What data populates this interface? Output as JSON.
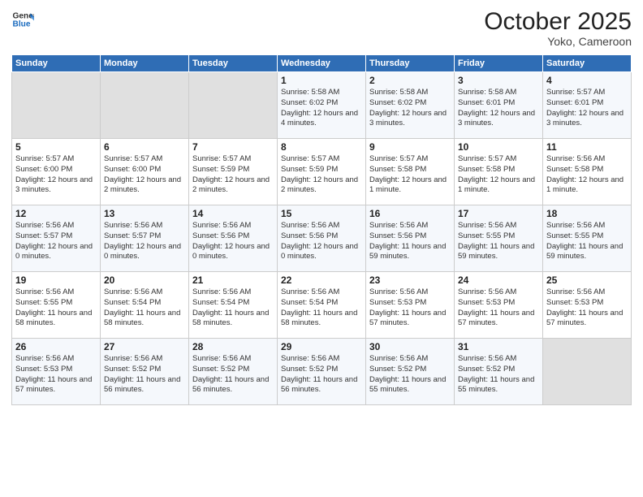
{
  "header": {
    "logo_line1": "General",
    "logo_line2": "Blue",
    "month": "October 2025",
    "location": "Yoko, Cameroon"
  },
  "weekdays": [
    "Sunday",
    "Monday",
    "Tuesday",
    "Wednesday",
    "Thursday",
    "Friday",
    "Saturday"
  ],
  "weeks": [
    [
      {
        "day": "",
        "empty": true
      },
      {
        "day": "",
        "empty": true
      },
      {
        "day": "",
        "empty": true
      },
      {
        "day": "1",
        "sunrise": "Sunrise: 5:58 AM",
        "sunset": "Sunset: 6:02 PM",
        "daylight": "Daylight: 12 hours and 4 minutes."
      },
      {
        "day": "2",
        "sunrise": "Sunrise: 5:58 AM",
        "sunset": "Sunset: 6:02 PM",
        "daylight": "Daylight: 12 hours and 3 minutes."
      },
      {
        "day": "3",
        "sunrise": "Sunrise: 5:58 AM",
        "sunset": "Sunset: 6:01 PM",
        "daylight": "Daylight: 12 hours and 3 minutes."
      },
      {
        "day": "4",
        "sunrise": "Sunrise: 5:57 AM",
        "sunset": "Sunset: 6:01 PM",
        "daylight": "Daylight: 12 hours and 3 minutes."
      }
    ],
    [
      {
        "day": "5",
        "sunrise": "Sunrise: 5:57 AM",
        "sunset": "Sunset: 6:00 PM",
        "daylight": "Daylight: 12 hours and 3 minutes."
      },
      {
        "day": "6",
        "sunrise": "Sunrise: 5:57 AM",
        "sunset": "Sunset: 6:00 PM",
        "daylight": "Daylight: 12 hours and 2 minutes."
      },
      {
        "day": "7",
        "sunrise": "Sunrise: 5:57 AM",
        "sunset": "Sunset: 5:59 PM",
        "daylight": "Daylight: 12 hours and 2 minutes."
      },
      {
        "day": "8",
        "sunrise": "Sunrise: 5:57 AM",
        "sunset": "Sunset: 5:59 PM",
        "daylight": "Daylight: 12 hours and 2 minutes."
      },
      {
        "day": "9",
        "sunrise": "Sunrise: 5:57 AM",
        "sunset": "Sunset: 5:58 PM",
        "daylight": "Daylight: 12 hours and 1 minute."
      },
      {
        "day": "10",
        "sunrise": "Sunrise: 5:57 AM",
        "sunset": "Sunset: 5:58 PM",
        "daylight": "Daylight: 12 hours and 1 minute."
      },
      {
        "day": "11",
        "sunrise": "Sunrise: 5:56 AM",
        "sunset": "Sunset: 5:58 PM",
        "daylight": "Daylight: 12 hours and 1 minute."
      }
    ],
    [
      {
        "day": "12",
        "sunrise": "Sunrise: 5:56 AM",
        "sunset": "Sunset: 5:57 PM",
        "daylight": "Daylight: 12 hours and 0 minutes."
      },
      {
        "day": "13",
        "sunrise": "Sunrise: 5:56 AM",
        "sunset": "Sunset: 5:57 PM",
        "daylight": "Daylight: 12 hours and 0 minutes."
      },
      {
        "day": "14",
        "sunrise": "Sunrise: 5:56 AM",
        "sunset": "Sunset: 5:56 PM",
        "daylight": "Daylight: 12 hours and 0 minutes."
      },
      {
        "day": "15",
        "sunrise": "Sunrise: 5:56 AM",
        "sunset": "Sunset: 5:56 PM",
        "daylight": "Daylight: 12 hours and 0 minutes."
      },
      {
        "day": "16",
        "sunrise": "Sunrise: 5:56 AM",
        "sunset": "Sunset: 5:56 PM",
        "daylight": "Daylight: 11 hours and 59 minutes."
      },
      {
        "day": "17",
        "sunrise": "Sunrise: 5:56 AM",
        "sunset": "Sunset: 5:55 PM",
        "daylight": "Daylight: 11 hours and 59 minutes."
      },
      {
        "day": "18",
        "sunrise": "Sunrise: 5:56 AM",
        "sunset": "Sunset: 5:55 PM",
        "daylight": "Daylight: 11 hours and 59 minutes."
      }
    ],
    [
      {
        "day": "19",
        "sunrise": "Sunrise: 5:56 AM",
        "sunset": "Sunset: 5:55 PM",
        "daylight": "Daylight: 11 hours and 58 minutes."
      },
      {
        "day": "20",
        "sunrise": "Sunrise: 5:56 AM",
        "sunset": "Sunset: 5:54 PM",
        "daylight": "Daylight: 11 hours and 58 minutes."
      },
      {
        "day": "21",
        "sunrise": "Sunrise: 5:56 AM",
        "sunset": "Sunset: 5:54 PM",
        "daylight": "Daylight: 11 hours and 58 minutes."
      },
      {
        "day": "22",
        "sunrise": "Sunrise: 5:56 AM",
        "sunset": "Sunset: 5:54 PM",
        "daylight": "Daylight: 11 hours and 58 minutes."
      },
      {
        "day": "23",
        "sunrise": "Sunrise: 5:56 AM",
        "sunset": "Sunset: 5:53 PM",
        "daylight": "Daylight: 11 hours and 57 minutes."
      },
      {
        "day": "24",
        "sunrise": "Sunrise: 5:56 AM",
        "sunset": "Sunset: 5:53 PM",
        "daylight": "Daylight: 11 hours and 57 minutes."
      },
      {
        "day": "25",
        "sunrise": "Sunrise: 5:56 AM",
        "sunset": "Sunset: 5:53 PM",
        "daylight": "Daylight: 11 hours and 57 minutes."
      }
    ],
    [
      {
        "day": "26",
        "sunrise": "Sunrise: 5:56 AM",
        "sunset": "Sunset: 5:53 PM",
        "daylight": "Daylight: 11 hours and 57 minutes."
      },
      {
        "day": "27",
        "sunrise": "Sunrise: 5:56 AM",
        "sunset": "Sunset: 5:52 PM",
        "daylight": "Daylight: 11 hours and 56 minutes."
      },
      {
        "day": "28",
        "sunrise": "Sunrise: 5:56 AM",
        "sunset": "Sunset: 5:52 PM",
        "daylight": "Daylight: 11 hours and 56 minutes."
      },
      {
        "day": "29",
        "sunrise": "Sunrise: 5:56 AM",
        "sunset": "Sunset: 5:52 PM",
        "daylight": "Daylight: 11 hours and 56 minutes."
      },
      {
        "day": "30",
        "sunrise": "Sunrise: 5:56 AM",
        "sunset": "Sunset: 5:52 PM",
        "daylight": "Daylight: 11 hours and 55 minutes."
      },
      {
        "day": "31",
        "sunrise": "Sunrise: 5:56 AM",
        "sunset": "Sunset: 5:52 PM",
        "daylight": "Daylight: 11 hours and 55 minutes."
      },
      {
        "day": "",
        "empty": true
      }
    ]
  ]
}
